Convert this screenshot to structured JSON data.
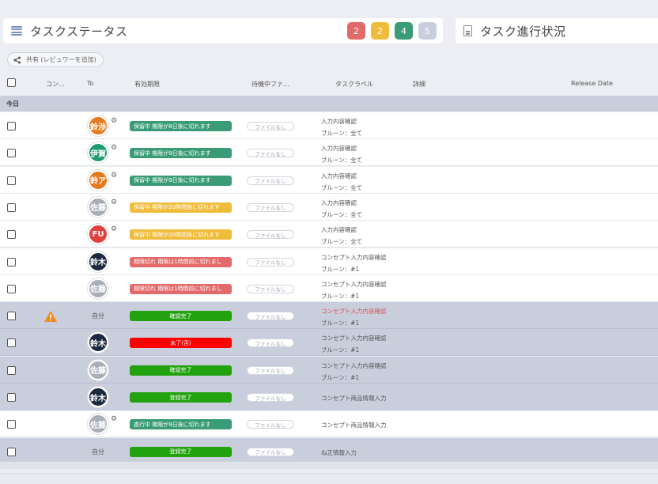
{
  "header": {
    "left_title": "タスクステータス",
    "right_title": "タスク進行状況",
    "badges": [
      {
        "value": "2",
        "color": "#e36a6a"
      },
      {
        "value": "2",
        "color": "#f0bc3c"
      },
      {
        "value": "4",
        "color": "#3a9c76"
      },
      {
        "value": "5",
        "color": "#c9cedd"
      }
    ]
  },
  "share_button": {
    "label": "共有 (レビュワーを追加)"
  },
  "columns": {
    "concept": "コン…",
    "to": "To",
    "deadline": "有効期限",
    "waiting_file": "待機中ファ…",
    "task_label": "タスクラベル",
    "detail": "詳細",
    "release_date": "Release Date"
  },
  "group": {
    "label": "今日"
  },
  "rows": [
    {
      "bg": "white",
      "avatar": {
        "text": "鈴渉",
        "color": "#e57a1e"
      },
      "gear": true,
      "status": {
        "text": "保留中 期限が8日後に切れます",
        "color": "#3a9c76"
      },
      "file": "ファイルなし",
      "label1": "入力内容確認",
      "label2": "ブルーン：全て"
    },
    {
      "bg": "white",
      "avatar": {
        "text": "伊賀",
        "color": "#1f9b73"
      },
      "gear": true,
      "status": {
        "text": "保留中 期限が9日後に切れます",
        "color": "#3a9c76"
      },
      "file": "ファイルなし",
      "label1": "入力内容確認",
      "label2": "ブルーン：全て"
    },
    {
      "bg": "white",
      "avatar": {
        "text": "鈴ア",
        "color": "#e57a1e"
      },
      "gear": true,
      "status": {
        "text": "保留中 期限が9日後に切れます",
        "color": "#3a9c76"
      },
      "file": "ファイルなし",
      "label1": "入力内容確認",
      "label2": "ブルーン：全て"
    },
    {
      "bg": "white",
      "avatar": {
        "text": "佐藤",
        "color": "#a9aeb8"
      },
      "gear": true,
      "status": {
        "text": "保留中 期限が20時間後に切れます",
        "color": "#f0bc3c"
      },
      "file": "ファイルなし",
      "label1": "入力内容確認",
      "label2": "ブルーン：全て"
    },
    {
      "bg": "white",
      "avatar": {
        "text": "FU",
        "color": "#e0413d"
      },
      "gear": true,
      "status": {
        "text": "保留中 期限が20時間後に切れます",
        "color": "#f0bc3c"
      },
      "file": "ファイルなし",
      "label1": "入力内容確認",
      "label2": "ブルーン：全て"
    },
    {
      "bg": "white",
      "avatar": {
        "text": "鈴木",
        "color": "#1c2a40"
      },
      "gear": false,
      "status": {
        "text": "期限切れ 期限は1時間前に切れまし",
        "color": "#e36a6a"
      },
      "file": "ファイルなし",
      "label1": "コンセプト入力内容確認",
      "label2": "ブルーン：#1"
    },
    {
      "bg": "white",
      "avatar": {
        "text": "佐藤",
        "color": "#a9aeb8"
      },
      "gear": false,
      "status": {
        "text": "期限切れ 期限は1時間前に切れまし",
        "color": "#e36a6a"
      },
      "file": "ファイルなし",
      "label1": "コンセプト入力内容確認",
      "label2": "ブルーン：#1"
    },
    {
      "bg": "grey",
      "warning": true,
      "self": "自分",
      "status": {
        "text": "確認完了",
        "color": "#22a20e",
        "center": true
      },
      "file": "ファイルなし",
      "label1": "コンセプト入力内容確認",
      "label1_red": true,
      "label2": "ブルーン：#1"
    },
    {
      "bg": "grey",
      "avatar": {
        "text": "鈴木",
        "color": "#1c2a40"
      },
      "gear": false,
      "status": {
        "text": "未了(否)",
        "color": "#ff0000",
        "center": true
      },
      "file": "ファイルなし",
      "label1": "コンセプト入力内容確認",
      "label2": "ブルーン：#1"
    },
    {
      "bg": "grey",
      "avatar": {
        "text": "佐藤",
        "color": "#a9aeb8"
      },
      "gear": false,
      "status": {
        "text": "確認完了",
        "color": "#22a20e",
        "center": true
      },
      "file": "ファイルなし",
      "label1": "コンセプト入力内容確認",
      "label2": "ブルーン：#1"
    },
    {
      "bg": "grey",
      "avatar": {
        "text": "鈴木",
        "color": "#1c2a40"
      },
      "gear": false,
      "status": {
        "text": "登録完了",
        "color": "#22a20e",
        "center": true
      },
      "file": "ファイルなし",
      "label_single": "コンセプト商品情報入力"
    },
    {
      "bg": "white",
      "avatar": {
        "text": "佐藤",
        "color": "#a9aeb8"
      },
      "gear": true,
      "status": {
        "text": "進行中 期限が9日後に切れます",
        "color": "#3a9c76"
      },
      "file": "ファイルなし",
      "label_single": "コンセプト商品情報入力"
    },
    {
      "bg": "grey",
      "self": "自分",
      "status": {
        "text": "登録完了",
        "color": "#22a20e",
        "center": true
      },
      "file": "ファイルなし",
      "label_single": "ね正情報入力"
    }
  ]
}
